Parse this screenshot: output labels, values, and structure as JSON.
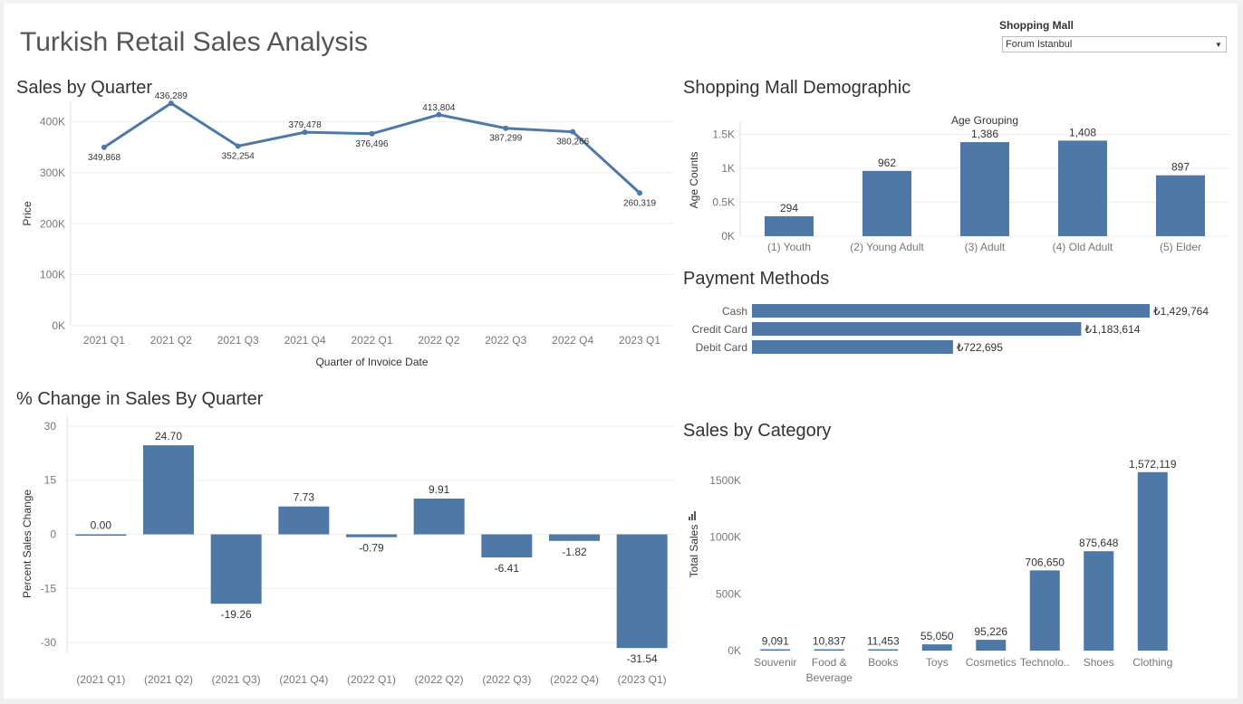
{
  "dashboard": {
    "title": "Turkish Retail Sales Analysis",
    "filter": {
      "label": "Shopping Mall",
      "selected": "Forum Istanbul"
    }
  },
  "sections": {
    "sales_by_quarter": "Sales by Quarter",
    "demographic": "Shopping Mall Demographic",
    "payment_methods": "Payment Methods",
    "pct_change": "% Change in Sales By Quarter",
    "category": "Sales by Category"
  },
  "colors": {
    "bar": "#4e79a7",
    "line": "#4e79a7",
    "grid": "#eeeeee"
  },
  "icons": {
    "category_chart": "bar-chart-icon"
  },
  "chart_data": [
    {
      "id": "sales_by_quarter",
      "type": "line",
      "x": [
        "2021 Q1",
        "2021 Q2",
        "2021 Q3",
        "2021 Q4",
        "2022 Q1",
        "2022 Q2",
        "2022 Q3",
        "2022 Q4",
        "2023 Q1"
      ],
      "values": [
        349868,
        436289,
        352254,
        379478,
        376496,
        413804,
        387299,
        380266,
        260319
      ],
      "data_labels": [
        "349,868",
        "436,289",
        "352,254",
        "379,478",
        "376,496",
        "413,804",
        "387,299",
        "380,266",
        "260,319"
      ],
      "xlabel": "Quarter of Invoice Date",
      "ylabel": "Price",
      "ylim": [
        0,
        440000
      ],
      "yticks": [
        0,
        100000,
        200000,
        300000,
        400000
      ],
      "ytick_labels": [
        "0K",
        "100K",
        "200K",
        "300K",
        "400K"
      ],
      "grid": true
    },
    {
      "id": "demographic",
      "type": "bar",
      "title": "Age Grouping",
      "categories": [
        "(1) Youth",
        "(2) Young Adult",
        "(3) Adult",
        "(4) Old Adult",
        "(5) Elder"
      ],
      "values": [
        294,
        962,
        1386,
        1408,
        897
      ],
      "data_labels": [
        "294",
        "962",
        "1,386",
        "1,408",
        "897"
      ],
      "ylabel": "Age Counts",
      "ylim": [
        0,
        1600
      ],
      "yticks": [
        0,
        500,
        1000,
        1500
      ],
      "ytick_labels": [
        "0K",
        "0.5K",
        "1K",
        "1.5K"
      ],
      "grid": true
    },
    {
      "id": "payment_methods",
      "type": "bar",
      "orientation": "horizontal",
      "categories": [
        "Cash",
        "Credit Card",
        "Debit Card"
      ],
      "values": [
        1429764,
        1183614,
        722695
      ],
      "data_labels": [
        "₺1,429,764",
        "₺1,183,614",
        "₺722,695"
      ]
    },
    {
      "id": "pct_change",
      "type": "bar",
      "categories": [
        "(2021 Q1)",
        "(2021 Q2)",
        "(2021 Q3)",
        "(2021 Q4)",
        "(2022 Q1)",
        "(2022 Q2)",
        "(2022 Q3)",
        "(2022 Q4)",
        "(2023 Q1)"
      ],
      "values": [
        0.0,
        24.7,
        -19.26,
        7.73,
        -0.79,
        9.91,
        -6.41,
        -1.82,
        -31.54
      ],
      "data_labels": [
        "0.00",
        "24.70",
        "-19.26",
        "7.73",
        "-0.79",
        "9.91",
        "-6.41",
        "-1.82",
        "-31.54"
      ],
      "ylabel": "Percent Sales Change",
      "ylim": [
        -33,
        33
      ],
      "yticks": [
        -30,
        -15,
        0,
        15,
        30
      ],
      "ytick_labels": [
        "-30",
        "-15",
        "0",
        "15",
        "30"
      ],
      "grid": true
    },
    {
      "id": "category",
      "type": "bar",
      "categories": [
        "Souvenir",
        "Food &\nBeverage",
        "Books",
        "Toys",
        "Cosmetics",
        "Technolo..",
        "Shoes",
        "Clothing"
      ],
      "values": [
        9091,
        10837,
        11453,
        55050,
        95226,
        706650,
        875648,
        1572119
      ],
      "data_labels": [
        "9,091",
        "10,837",
        "11,453",
        "55,050",
        "95,226",
        "706,650",
        "875,648",
        "1,572,119"
      ],
      "ylabel": "Total Sales",
      "ylim": [
        0,
        1650000
      ],
      "yticks": [
        0,
        500000,
        1000000,
        1500000
      ],
      "ytick_labels": [
        "0K",
        "500K",
        "1000K",
        "1500K"
      ],
      "grid": false
    }
  ]
}
